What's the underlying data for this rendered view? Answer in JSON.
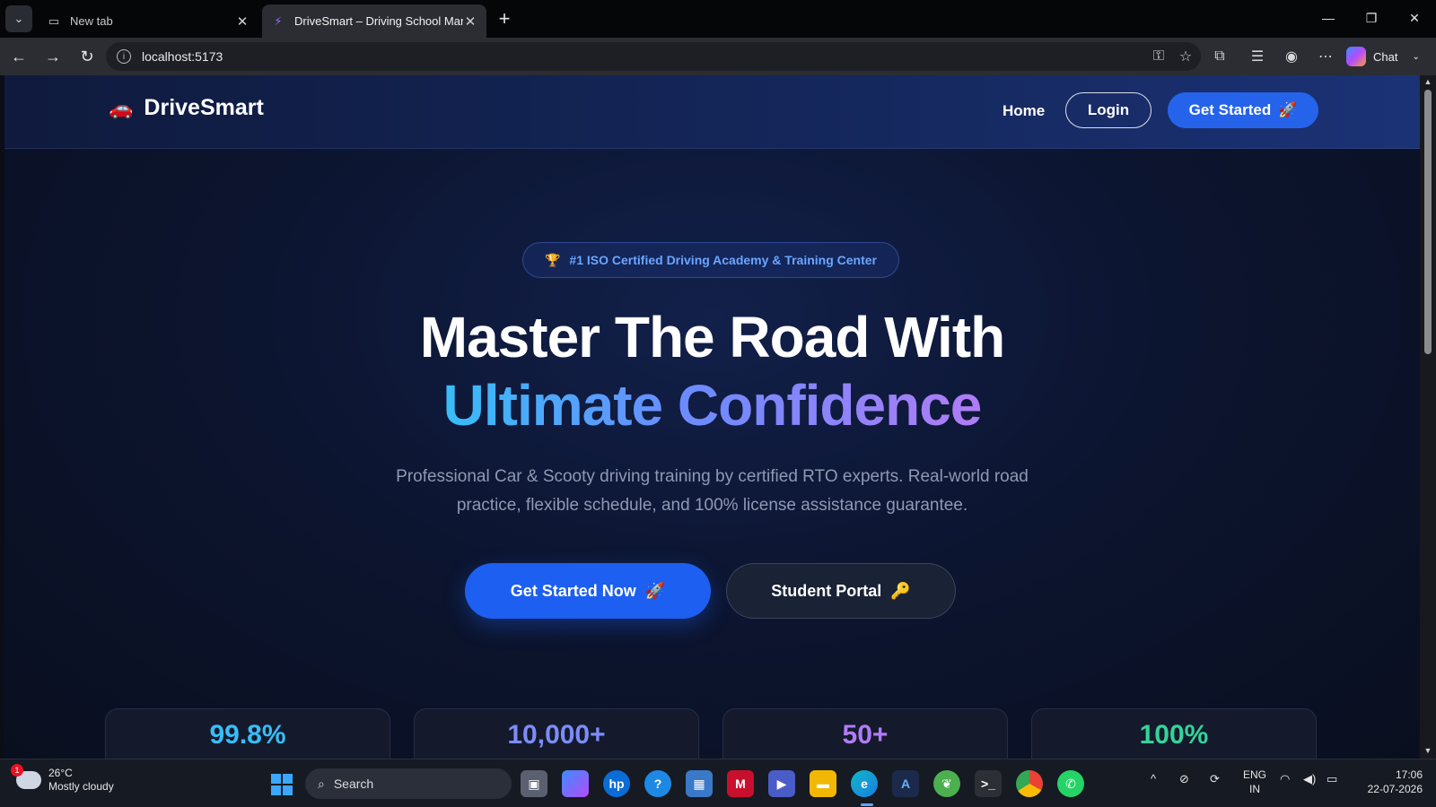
{
  "browser": {
    "tabs": [
      {
        "title": "New tab",
        "active": false
      },
      {
        "title": "DriveSmart – Driving School Mana",
        "active": true
      }
    ],
    "address": "localhost:5173",
    "chat_label": "Chat"
  },
  "site": {
    "brand": "DriveSmart",
    "brand_icon": "🚗",
    "nav": {
      "home": "Home",
      "login": "Login",
      "get_started": "Get Started",
      "get_started_icon": "🚀"
    },
    "badge": {
      "icon": "🏆",
      "text": "#1 ISO Certified Driving Academy & Training Center"
    },
    "hero": {
      "title_line1": "Master The Road With",
      "title_line2": "Ultimate Confidence",
      "subtitle": "Professional Car & Scooty driving training by certified RTO experts. Real-world road practice, flexible schedule, and 100% license assistance guarantee."
    },
    "cta": {
      "primary": "Get Started Now",
      "primary_icon": "🚀",
      "secondary": "Student Portal",
      "secondary_icon": "🔑"
    },
    "stats": [
      {
        "value": "99.8%",
        "color": "#38bdf8"
      },
      {
        "value": "10,000+",
        "color": "#7c8cf8"
      },
      {
        "value": "50+",
        "color": "#b07cf5"
      },
      {
        "value": "100%",
        "color": "#34d399"
      }
    ]
  },
  "taskbar": {
    "weather": {
      "temp": "26°C",
      "condition": "Mostly cloudy",
      "alerts": "1"
    },
    "search_label": "Search",
    "lang": {
      "line1": "ENG",
      "line2": "IN"
    },
    "clock": {
      "time": "17:06",
      "date": "22-07-2026"
    }
  }
}
